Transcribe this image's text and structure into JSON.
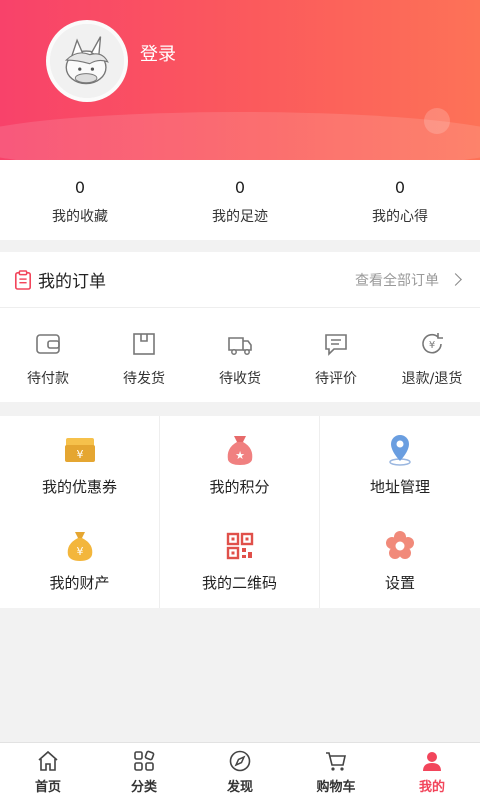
{
  "header": {
    "login_label": "登录"
  },
  "stats": [
    {
      "count": "0",
      "label": "我的收藏"
    },
    {
      "count": "0",
      "label": "我的足迹"
    },
    {
      "count": "0",
      "label": "我的心得"
    }
  ],
  "orders": {
    "title": "我的订单",
    "view_all": "查看全部订单",
    "items": [
      {
        "label": "待付款",
        "icon": "wallet-icon"
      },
      {
        "label": "待发货",
        "icon": "box-icon"
      },
      {
        "label": "待收货",
        "icon": "truck-icon"
      },
      {
        "label": "待评价",
        "icon": "comment-icon"
      },
      {
        "label": "退款/退货",
        "icon": "refund-icon"
      }
    ]
  },
  "services": [
    {
      "label": "我的优惠券",
      "icon": "coupon-icon"
    },
    {
      "label": "我的积分",
      "icon": "points-bag-icon"
    },
    {
      "label": "地址管理",
      "icon": "location-pin-icon"
    },
    {
      "label": "我的财产",
      "icon": "money-bag-icon"
    },
    {
      "label": "我的二维码",
      "icon": "qr-code-icon"
    },
    {
      "label": "设置",
      "icon": "settings-flower-icon"
    }
  ],
  "tabbar": [
    {
      "label": "首页",
      "icon": "home-icon"
    },
    {
      "label": "分类",
      "icon": "category-icon"
    },
    {
      "label": "发现",
      "icon": "compass-icon"
    },
    {
      "label": "购物车",
      "icon": "cart-icon"
    },
    {
      "label": "我的",
      "icon": "user-icon",
      "active": true
    }
  ],
  "colors": {
    "brand": "#f2455b",
    "gradient_start": "#f8426a",
    "gradient_end": "#fd7257"
  }
}
